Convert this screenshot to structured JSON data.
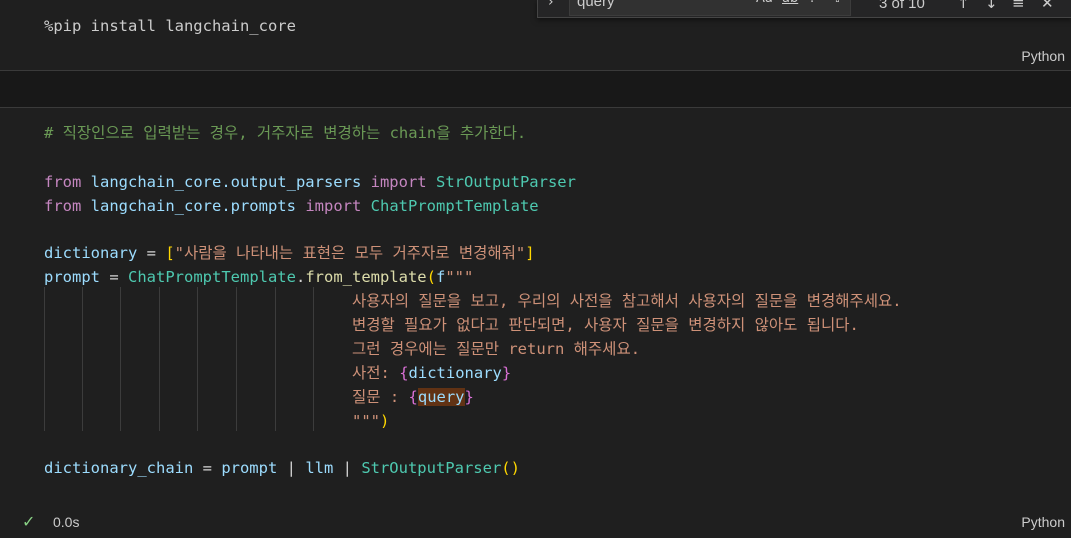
{
  "cell1": {
    "code": "%pip install langchain_core",
    "language": "Python"
  },
  "cell2": {
    "comment": "# 직장인으로 입력받는 경우, 거주자로 변경하는 chain을 추가한다.",
    "l2": {
      "kw_from": "from",
      "mod": "langchain_core.output_parsers",
      "kw_import": "import",
      "cls": "StrOutputParser"
    },
    "l3": {
      "kw_from": "from",
      "mod": "langchain_core.prompts",
      "kw_import": "import",
      "cls": "ChatPromptTemplate"
    },
    "l4": {
      "var": "dictionary",
      "op": " = ",
      "open": "[",
      "str": "\"사람을 나타내는 표현은 모두 거주자로 변경해줘\"",
      "close": "]"
    },
    "l5": {
      "var": "prompt",
      "op": " = ",
      "cls": "ChatPromptTemplate",
      "dot": ".",
      "fn": "from_template",
      "open": "(",
      "fpre": "f",
      "str": "\"\"\""
    },
    "t1": "사용자의 질문을 보고, 우리의 사전을 참고해서 사용자의 질문을 변경해주세요.",
    "t2": "변경할 필요가 없다고 판단되면, 사용자 질문을 변경하지 않아도 됩니다.",
    "t3": "그런 경우에는 질문만 return 해주세요.",
    "t4": {
      "pre": "사전: ",
      "ob": "{",
      "var": "dictionary",
      "cb": "}"
    },
    "t5": {
      "pre": "질문 : ",
      "ob": "{",
      "var": "query",
      "cb": "}"
    },
    "t6": {
      "str": "\"\"\"",
      "close": ")"
    },
    "l6": {
      "var1": "dictionary_chain",
      "op1": " = ",
      "var2": "prompt",
      "pipe1": " | ",
      "var3": "llm",
      "pipe2": " | ",
      "cls": "StrOutputParser",
      "parens": "()"
    },
    "status": {
      "icon": "check-icon",
      "time": "0.0s"
    },
    "language": "Python"
  },
  "find_widget": {
    "query": "query",
    "match_case": "Aa",
    "whole_word": "ab",
    "regex": ".*",
    "count": "3 of 10"
  },
  "colors": {
    "keyword": "#c586c0",
    "variable": "#9cdcfe",
    "class": "#4ec9b0",
    "function": "#dcdcaa",
    "string": "#ce9178",
    "comment": "#6a9955",
    "bracket_gold": "#ffd700",
    "bracket_pink": "#da70d6",
    "success": "#89d185"
  }
}
